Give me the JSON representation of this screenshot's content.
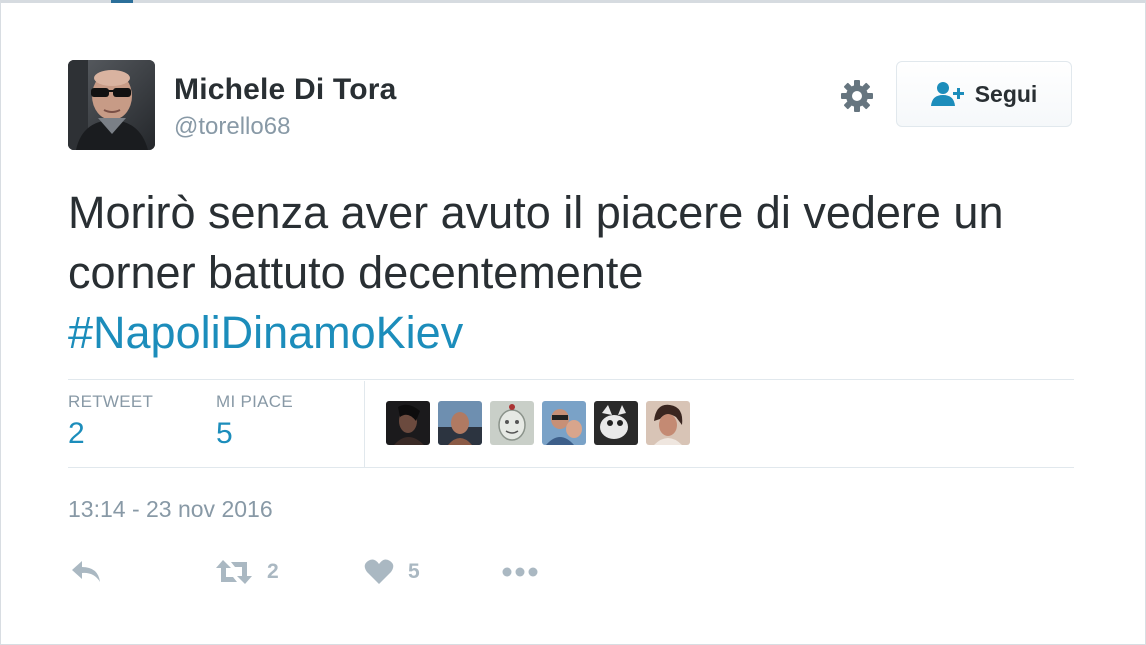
{
  "tweet": {
    "author": {
      "display_name": "Michele Di Tora",
      "handle": "@torello68"
    },
    "follow_button": {
      "label": "Segui",
      "icon": "follow-person-plus-icon"
    },
    "settings_icon": "gear-icon",
    "text_lines": [
      "Morirò senza aver avuto il piacere di vedere un",
      "corner battuto decentemente"
    ],
    "hashtag": "#NapoliDinamoKiev",
    "stats": {
      "retweet_label": "RETWEET",
      "retweet_count": "2",
      "likes_label": "MI PIACE",
      "likes_count": "5",
      "liker_avatars": 6
    },
    "timestamp": "13:14 - 23 nov 2016",
    "actions": {
      "reply_icon": "reply-icon",
      "retweet_icon": "retweet-icon",
      "retweet_count": "2",
      "like_icon": "heart-icon",
      "like_count": "5",
      "more_icon": "more-dots-icon"
    },
    "colors": {
      "link": "#1c8dbb",
      "text": "#292f33",
      "muted": "#8899a6",
      "icon": "#aab8c2"
    }
  }
}
